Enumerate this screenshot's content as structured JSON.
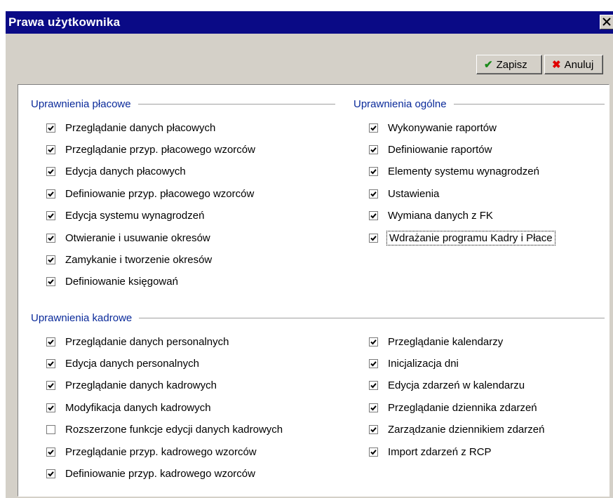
{
  "window": {
    "title": "Prawa użytkownika"
  },
  "toolbar": {
    "save_label": "Zapisz",
    "cancel_label": "Anuluj"
  },
  "groups": {
    "placowe": {
      "title": "Uprawnienia płacowe",
      "items": [
        {
          "label": "Przeglądanie danych płacowych",
          "checked": true
        },
        {
          "label": "Przeglądanie przyp. płacowego wzorców",
          "checked": true
        },
        {
          "label": "Edycja danych płacowych",
          "checked": true
        },
        {
          "label": "Definiowanie przyp. płacowego wzorców",
          "checked": true
        },
        {
          "label": "Edycja systemu wynagrodzeń",
          "checked": true
        },
        {
          "label": "Otwieranie i usuwanie okresów",
          "checked": true
        },
        {
          "label": "Zamykanie i tworzenie okresów",
          "checked": true
        },
        {
          "label": "Definiowanie księgowań",
          "checked": true
        }
      ]
    },
    "ogolne": {
      "title": "Uprawnienia ogólne",
      "items": [
        {
          "label": "Wykonywanie raportów",
          "checked": true
        },
        {
          "label": "Definiowanie raportów",
          "checked": true
        },
        {
          "label": "Elementy systemu wynagrodzeń",
          "checked": true
        },
        {
          "label": "Ustawienia",
          "checked": true
        },
        {
          "label": "Wymiana danych z FK",
          "checked": true
        },
        {
          "label": "Wdrażanie programu Kadry i Płace",
          "checked": true
        }
      ]
    },
    "kadrowe": {
      "title": "Uprawnienia kadrowe",
      "left_items": [
        {
          "label": "Przeglądanie danych personalnych",
          "checked": true
        },
        {
          "label": "Edycja danych personalnych",
          "checked": true
        },
        {
          "label": "Przeglądanie danych kadrowych",
          "checked": true
        },
        {
          "label": "Modyfikacja danych kadrowych",
          "checked": true
        },
        {
          "label": "Rozszerzone funkcje edycji danych kadrowych",
          "checked": false
        },
        {
          "label": "Przeglądanie przyp. kadrowego wzorców",
          "checked": true
        },
        {
          "label": "Definiowanie przyp. kadrowego wzorców",
          "checked": true
        }
      ],
      "right_items": [
        {
          "label": "Przeglądanie kalendarzy",
          "checked": true
        },
        {
          "label": "Inicjalizacja dni",
          "checked": true
        },
        {
          "label": "Edycja zdarzeń w kalendarzu",
          "checked": true
        },
        {
          "label": "Przeglądanie dziennika zdarzeń",
          "checked": true
        },
        {
          "label": "Zarządzanie dziennikiem zdarzeń",
          "checked": true
        },
        {
          "label": "Import zdarzeń z RCP",
          "checked": true
        }
      ]
    }
  },
  "icons": {
    "save": "checkmark-icon",
    "cancel": "x-icon",
    "close": "close-icon"
  },
  "colors": {
    "title_bar": "#0a0a86",
    "group_title": "#0a2a9a",
    "save_icon": "#1a8a1a",
    "cancel_icon": "#e00000"
  }
}
